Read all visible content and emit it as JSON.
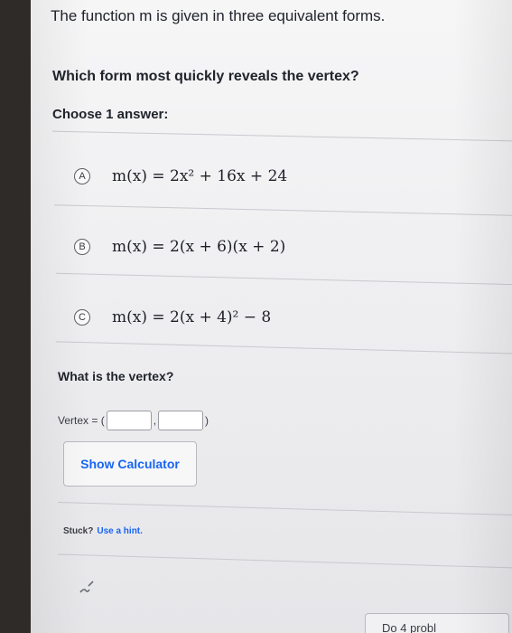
{
  "question": {
    "title": "The function m is given in three equivalent forms.",
    "prompt": "Which form most quickly reveals the vertex?",
    "instruction": "Choose 1 answer:"
  },
  "choices": [
    {
      "letter": "A",
      "formula": "m(x) = 2x² + 16x + 24"
    },
    {
      "letter": "B",
      "formula": "m(x) = 2(x + 6)(x + 2)"
    },
    {
      "letter": "C",
      "formula": "m(x) = 2(x + 4)² − 8"
    }
  ],
  "vertex": {
    "question": "What is the vertex?",
    "label": "Vertex = (",
    "separator": ",",
    "close": ")",
    "x_value": "",
    "y_value": ""
  },
  "buttons": {
    "calculator": "Show Calculator",
    "next": "Do 4 probl"
  },
  "hint": {
    "stuck": "Stuck?",
    "link": "Use a hint."
  },
  "icons": {
    "pen": "pen-icon"
  }
}
